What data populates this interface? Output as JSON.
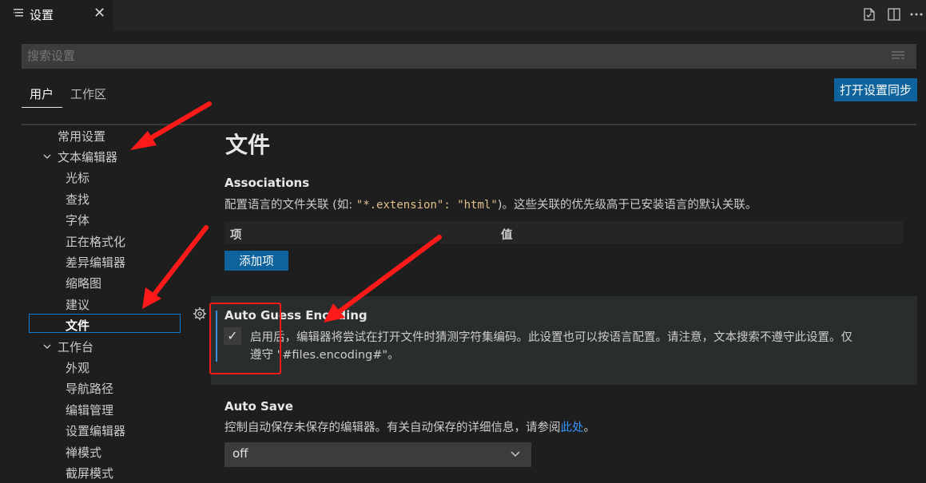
{
  "tab": {
    "label": "设置",
    "close": "✕"
  },
  "title_bar_icons": [
    "open-json-icon",
    "split-editor-icon",
    "more-actions-icon"
  ],
  "search": {
    "placeholder": "搜索设置"
  },
  "scope_tabs": {
    "user": "用户",
    "workspace": "工作区"
  },
  "sync_button": "打开设置同步",
  "tree": [
    {
      "label": "常用设置",
      "level": 0,
      "twisty": ""
    },
    {
      "label": "文本编辑器",
      "level": 0,
      "twisty": "⌵"
    },
    {
      "label": "光标",
      "level": 1
    },
    {
      "label": "查找",
      "level": 1
    },
    {
      "label": "字体",
      "level": 1
    },
    {
      "label": "正在格式化",
      "level": 1
    },
    {
      "label": "差异编辑器",
      "level": 1
    },
    {
      "label": "缩略图",
      "level": 1
    },
    {
      "label": "建议",
      "level": 1
    },
    {
      "label": "文件",
      "level": 1,
      "selected": true
    },
    {
      "label": "工作台",
      "level": 0,
      "twisty": "⌵"
    },
    {
      "label": "外观",
      "level": 1
    },
    {
      "label": "导航路径",
      "level": 1
    },
    {
      "label": "编辑管理",
      "level": 1
    },
    {
      "label": "设置编辑器",
      "level": 1
    },
    {
      "label": "禅模式",
      "level": 1
    },
    {
      "label": "截屏模式",
      "level": 1
    }
  ],
  "section_title": "文件",
  "associations": {
    "title": "Associations",
    "desc_before": "配置语言的文件关联 (如: ",
    "desc_code": "\"*.extension\": \"html\"",
    "desc_after": ")。这些关联的优先级高于已安装语言的默认关联。",
    "col_item": "项",
    "col_value": "值",
    "add_button": "添加项"
  },
  "auto_guess": {
    "title": "Auto Guess Encoding",
    "checked": true,
    "checkmark": "✓",
    "desc_line1": "启用后，编辑器将尝试在打开文件时猜测字符集编码。此设置也可以按语言配置。请注意，文本搜索不遵守此设置。仅",
    "desc_line2": "遵守 \"#files.encoding#\"。"
  },
  "auto_save": {
    "title": "Auto Save",
    "desc_before": "控制自动保存未保存的编辑器。有关自动保存的详细信息，请参阅",
    "desc_link": "此处",
    "desc_after": "。",
    "value": "off"
  },
  "colors": {
    "accent": "#0e639c",
    "annotation": "#ff1a1a",
    "link": "#3794ff"
  }
}
